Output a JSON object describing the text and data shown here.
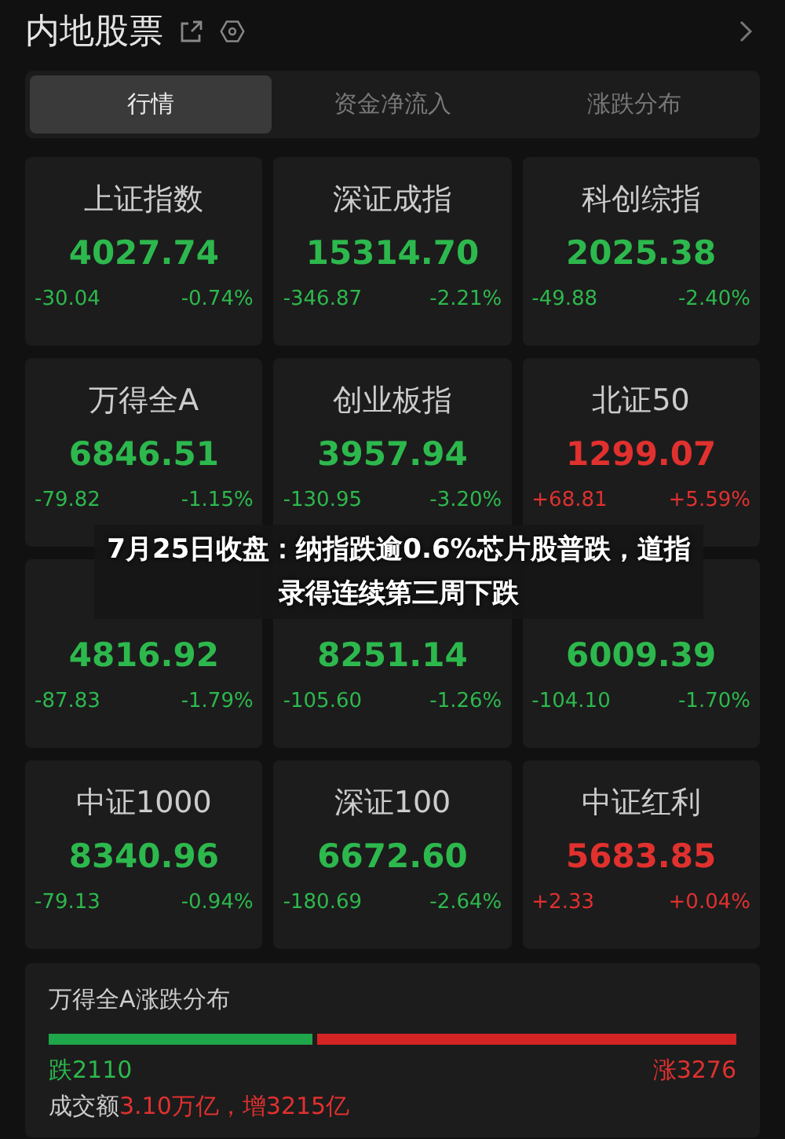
{
  "header": {
    "title": "内地股票"
  },
  "tabs": [
    {
      "label": "行情",
      "selected": true
    },
    {
      "label": "资金净流入",
      "selected": false
    },
    {
      "label": "涨跌分布",
      "selected": false
    }
  ],
  "indices": [
    {
      "name": "上证指数",
      "value": "4027.74",
      "change": "-30.04",
      "percent": "-0.74%",
      "color": "#2db84d"
    },
    {
      "name": "深证成指",
      "value": "15314.70",
      "change": "-346.87",
      "percent": "-2.21%",
      "color": "#2db84d"
    },
    {
      "name": "科创综指",
      "value": "2025.38",
      "change": "-49.88",
      "percent": "-2.40%",
      "color": "#2db84d"
    },
    {
      "name": "万得全A",
      "value": "6846.51",
      "change": "-79.82",
      "percent": "-1.15%",
      "color": "#2db84d"
    },
    {
      "name": "创业板指",
      "value": "3957.94",
      "change": "-130.95",
      "percent": "-3.20%",
      "color": "#2db84d"
    },
    {
      "name": "北证50",
      "value": "1299.07",
      "change": "+68.81",
      "percent": "+5.59%",
      "color": "#e0312f"
    },
    {
      "value": "4816.92",
      "change": "-87.83",
      "percent": "-1.79%",
      "color": "#2db84d"
    },
    {
      "value": "8251.14",
      "change": "-105.60",
      "percent": "-1.26%",
      "color": "#2db84d"
    },
    {
      "value": "6009.39",
      "change": "-104.10",
      "percent": "-1.70%",
      "color": "#2db84d"
    },
    {
      "name": "中证1000",
      "value": "8340.96",
      "change": "-79.13",
      "percent": "-0.94%",
      "color": "#2db84d"
    },
    {
      "name": "深证100",
      "value": "6672.60",
      "change": "-180.69",
      "percent": "-2.64%",
      "color": "#2db84d"
    },
    {
      "name": "中证红利",
      "value": "5683.85",
      "change": "+2.33",
      "percent": "+0.04%",
      "color": "#e0312f"
    }
  ],
  "distribution": {
    "title": "万得全A涨跌分布",
    "level": 0.39,
    "fall": "跌2110",
    "rise": "涨3276",
    "turnover_label": "成交额",
    "turnover_value": "3.10万亿，增3215亿"
  },
  "headline": "7月25日收盘：纳指跌逾0.6%芯片股普跌，道指录得连续第三周下跌"
}
